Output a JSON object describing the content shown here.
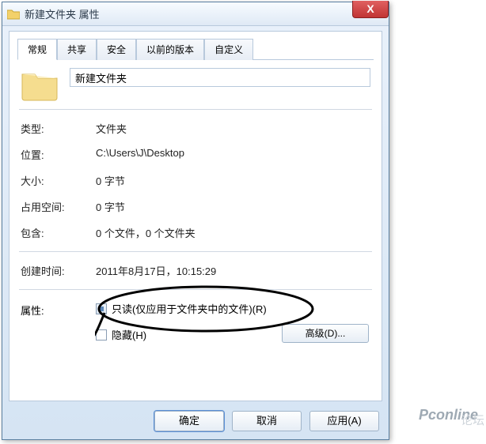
{
  "window": {
    "title": "新建文件夹 属性",
    "close_glyph": "X"
  },
  "tabs": [
    "常规",
    "共享",
    "安全",
    "以前的版本",
    "自定义"
  ],
  "name_value": "新建文件夹",
  "rows": {
    "type": {
      "label": "类型:",
      "value": "文件夹"
    },
    "location": {
      "label": "位置:",
      "value": "C:\\Users\\J\\Desktop"
    },
    "size": {
      "label": "大小:",
      "value": "0 字节"
    },
    "sizeondisk": {
      "label": "占用空间:",
      "value": "0 字节"
    },
    "contains": {
      "label": "包含:",
      "value": "0 个文件，0 个文件夹"
    },
    "created": {
      "label": "创建时间:",
      "value": "2011年8月17日，10:15:29"
    }
  },
  "attributes": {
    "label": "属性:",
    "readonly": "只读(仅应用于文件夹中的文件)(R)",
    "hidden": "隐藏(H)",
    "advanced": "高级(D)..."
  },
  "buttons": {
    "ok": "确定",
    "cancel": "取消",
    "apply": "应用(A)"
  },
  "watermark": {
    "text1": "Pconline",
    "text2": "论坛"
  }
}
